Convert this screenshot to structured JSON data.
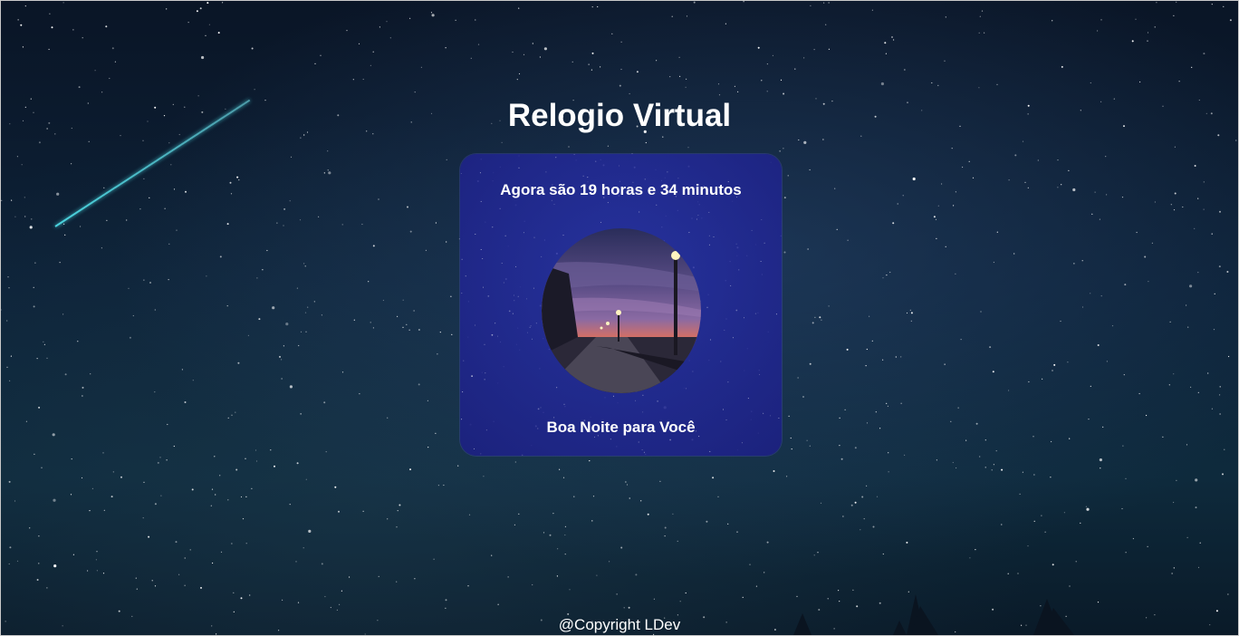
{
  "page": {
    "title": "Relogio Virtual"
  },
  "clock": {
    "time_message": "Agora são 19 horas e 34 minutos",
    "greeting": "Boa Noite para Você",
    "image_description_icon": "night-street-photo"
  },
  "footer": {
    "copyright": "@Copyright LDev"
  },
  "colors": {
    "card_background": "#2b2f9a",
    "text": "#ffffff",
    "sky": "#0d2238",
    "meteor": "#50e6f0"
  }
}
